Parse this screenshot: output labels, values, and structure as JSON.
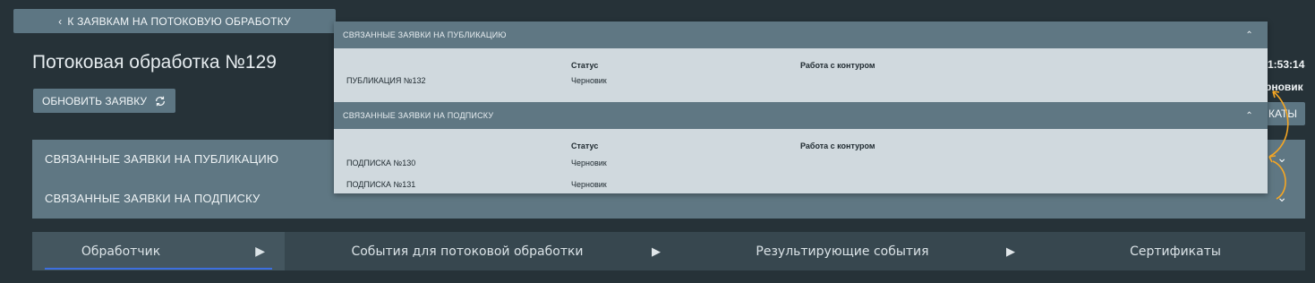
{
  "header": {
    "back_label": "К ЗАЯВКАМ НА ПОТОКОВУЮ ОБРАБОТКУ",
    "page_title": "Потоковая обработка №129",
    "refresh_label": "ОБНОВИТЬ ЗАЯВКУ"
  },
  "side_info": {
    "time_fragment": "1:53:14",
    "status_fragment": "рновик",
    "certs_button_fragment": "КАТЫ"
  },
  "linked": {
    "publication_label": "СВЯЗАННЫЕ ЗАЯВКИ НА ПУБЛИКАЦИЮ",
    "subscription_label": "СВЯЗАННЫЕ ЗАЯВКИ НА ПОДПИСКУ"
  },
  "popup": {
    "publication": {
      "title": "СВЯЗАННЫЕ ЗАЯВКИ НА ПУБЛИКАЦИЮ",
      "columns": [
        "Статус",
        "Работа с контуром"
      ],
      "rows": [
        {
          "name": "ПУБЛИКАЦИЯ №132",
          "status": "Черновик"
        }
      ]
    },
    "subscription": {
      "title": "СВЯЗАННЫЕ ЗАЯВКИ НА ПОДПИСКУ",
      "columns": [
        "Статус",
        "Работа с контуром"
      ],
      "rows": [
        {
          "name": "ПОДПИСКА №130",
          "status": "Черновик"
        },
        {
          "name": "ПОДПИСКА №131",
          "status": "Черновик"
        }
      ]
    }
  },
  "tabs": [
    {
      "label": "Обработчик",
      "active": true
    },
    {
      "label": "События для потоковой обработки",
      "active": false
    },
    {
      "label": "Результирующие события",
      "active": false
    },
    {
      "label": "Сертификаты",
      "active": false
    }
  ],
  "colors": {
    "background": "#263238",
    "panel": "#5f7783",
    "popup_body": "#d0d9de",
    "active_tab_underline": "#3d6fe0",
    "annotation_arrow": "#f5a623"
  },
  "icons": [
    "chevron-left-icon",
    "refresh-icon",
    "chevron-up-icon",
    "chevron-down-icon",
    "play-arrow-icon"
  ]
}
